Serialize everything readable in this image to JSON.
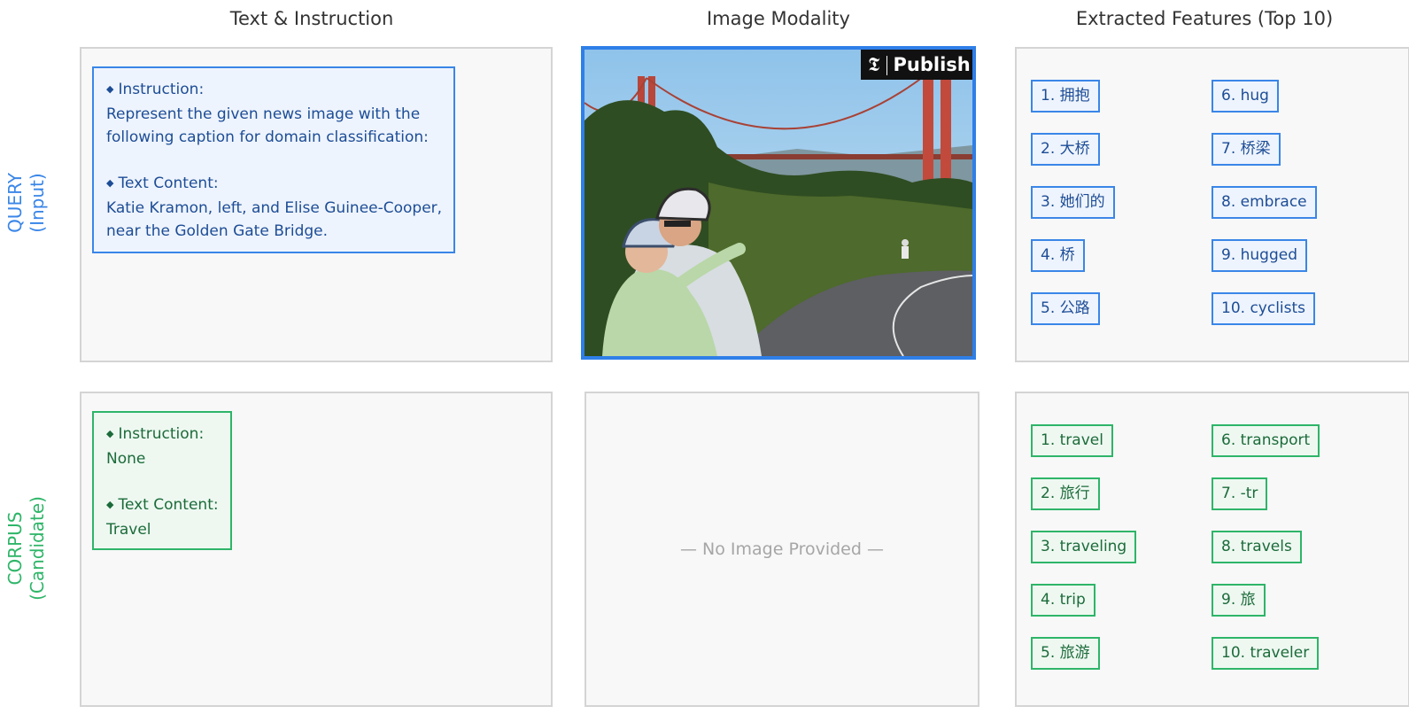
{
  "columns": {
    "text": "Text & Instruction",
    "image": "Image Modality",
    "features": "Extracted Features (Top 10)"
  },
  "rows": {
    "query": {
      "line1": "QUERY",
      "line2": "(Input)"
    },
    "corpus": {
      "line1": "CORPUS",
      "line2": "(Candidate)"
    }
  },
  "query": {
    "instruction_header": "Instruction:",
    "instruction_lines": [
      "Represent the given news image with the",
      "following caption for domain classification:"
    ],
    "content_header": "Text Content:",
    "content_lines": [
      "Katie Kramon, left, and Elise Guinee-Cooper,",
      "near the Golden Gate Bridge."
    ],
    "image_watermark": "Publish",
    "features": [
      "1. 拥抱",
      "2. 大桥",
      "3. 她们的",
      "4. 桥",
      "5. 公路",
      "6. hug",
      "7. 桥梁",
      "8. embrace",
      "9. hugged",
      "10. cyclists"
    ]
  },
  "corpus": {
    "instruction_header": "Instruction:",
    "instruction_lines": [
      "None"
    ],
    "content_header": "Text Content:",
    "content_lines": [
      "Travel"
    ],
    "no_image": "— No Image Provided —",
    "features": [
      "1. travel",
      "2. 旅行",
      "3. traveling",
      "4. trip",
      "5. 旅游",
      "6. transport",
      "7. -tr",
      "8. travels",
      "9. 旅",
      "10. traveler"
    ]
  },
  "colors": {
    "query_accent": "#3a86e8",
    "corpus_accent": "#2eb568",
    "panel_bg": "#f8f8f8",
    "panel_border": "#d4d4d4"
  }
}
